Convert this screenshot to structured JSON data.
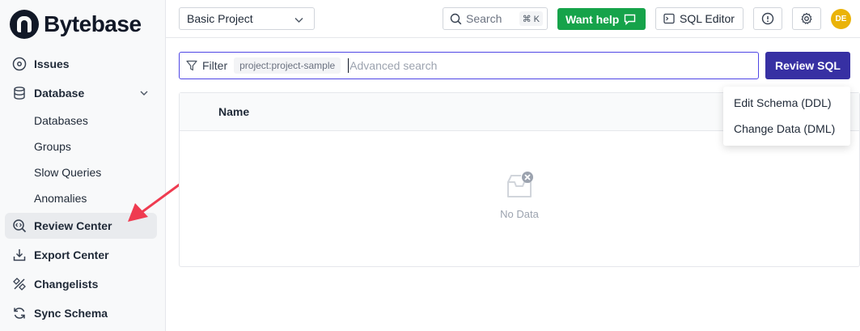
{
  "app": {
    "name": "Bytebase"
  },
  "sidebar": {
    "issues_label": "Issues",
    "database_label": "Database",
    "database_children": [
      "Databases",
      "Groups",
      "Slow Queries",
      "Anomalies"
    ],
    "review_center_label": "Review Center",
    "export_center_label": "Export Center",
    "changelists_label": "Changelists",
    "sync_schema_label": "Sync Schema",
    "active_item": "Review Center"
  },
  "header": {
    "project_selected": "Basic Project",
    "search_placeholder": "Search",
    "search_shortcut": "⌘ K",
    "want_help_label": "Want help",
    "sql_editor_label": "SQL Editor",
    "avatar_initials": "DE"
  },
  "filter": {
    "label": "Filter",
    "tag": "project:project-sample",
    "placeholder": "Advanced search"
  },
  "review_sql": {
    "label": "Review SQL",
    "menu": [
      "Edit Schema (DDL)",
      "Change Data (DML)"
    ]
  },
  "table": {
    "columns": [
      "Name"
    ],
    "empty_text": "No Data"
  },
  "colors": {
    "primary": "#3730a3",
    "focus_border": "#4f46e5",
    "help_green": "#16a34a",
    "annotation_arrow": "#ef3b50",
    "avatar": "#eab308"
  }
}
